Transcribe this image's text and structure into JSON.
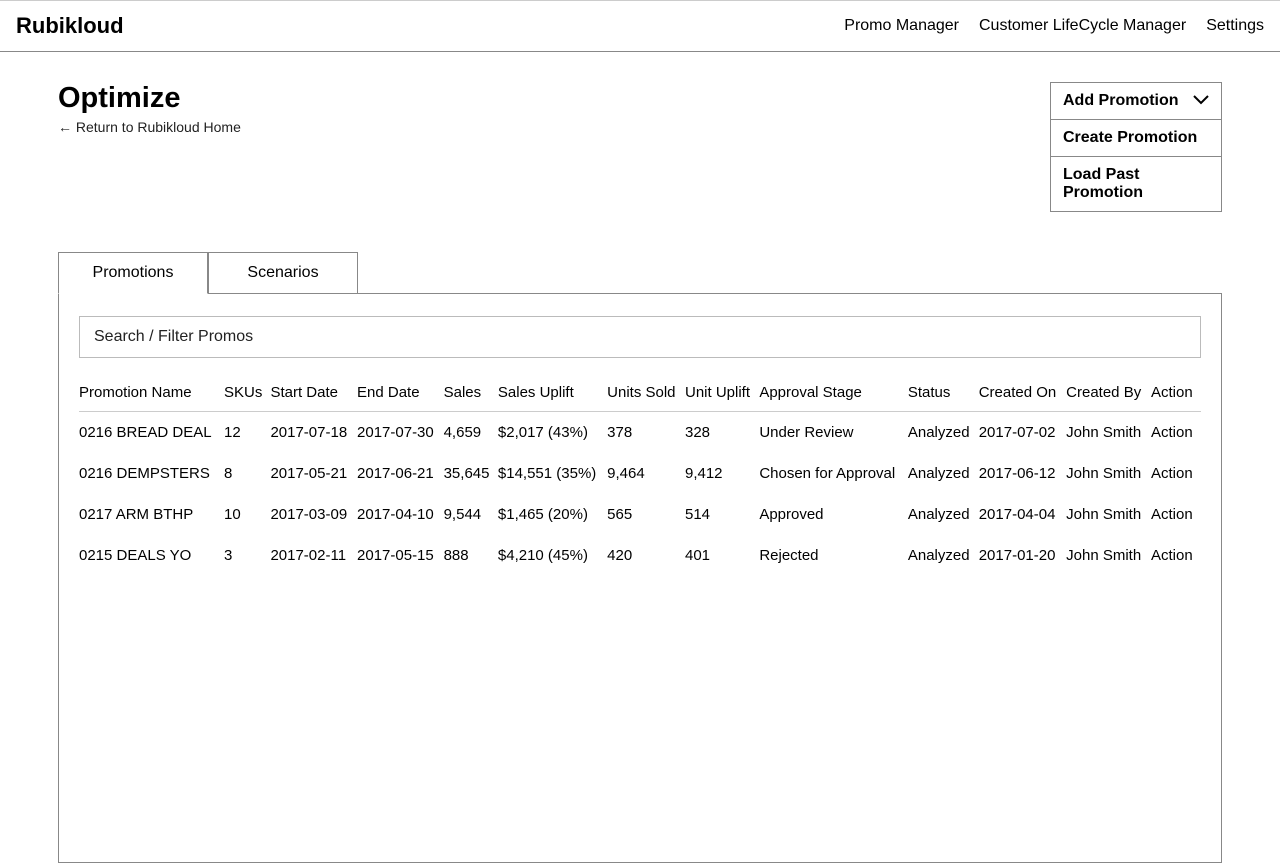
{
  "header": {
    "brand": "Rubikloud",
    "nav": [
      "Promo Manager",
      "Customer LifeCycle Manager",
      "Settings"
    ]
  },
  "page": {
    "title": "Optimize",
    "return_link": "← Return to Rubikloud Home"
  },
  "dropdown": {
    "label": "Add Promotion",
    "items": [
      "Create Promotion",
      "Load Past Promotion"
    ]
  },
  "tabs": {
    "items": [
      "Promotions",
      "Scenarios"
    ],
    "active": 0
  },
  "search": {
    "placeholder": "Search / Filter Promos"
  },
  "table": {
    "headers": [
      "Promotion Name",
      "SKUs",
      "Start Date",
      "End Date",
      "Sales",
      "Sales Uplift",
      "Units Sold",
      "Unit Uplift",
      "Approval Stage",
      "Status",
      "Created On",
      "Created By",
      "Action"
    ],
    "rows": [
      {
        "name": "0216 BREAD DEAL",
        "skus": "12",
        "start": "2017-07-18",
        "end": "2017-07-30",
        "sales": "4,659",
        "uplift": "$2,017 (43%)",
        "units": "378",
        "unit_uplift": "328",
        "stage": "Under Review",
        "status": "Analyzed",
        "created_on": "2017-07-02",
        "created_by": "John Smith",
        "action": "Action"
      },
      {
        "name": "0216 DEMPSTERS",
        "skus": "8",
        "start": "2017-05-21",
        "end": "2017-06-21",
        "sales": "35,645",
        "uplift": "$14,551 (35%)",
        "units": "9,464",
        "unit_uplift": "9,412",
        "stage": "Chosen for Approval",
        "status": "Analyzed",
        "created_on": "2017-06-12",
        "created_by": "John Smith",
        "action": "Action"
      },
      {
        "name": "0217 ARM BTHP",
        "skus": "10",
        "start": "2017-03-09",
        "end": "2017-04-10",
        "sales": "9,544",
        "uplift": "$1,465 (20%)",
        "units": "565",
        "unit_uplift": "514",
        "stage": "Approved",
        "status": "Analyzed",
        "created_on": "2017-04-04",
        "created_by": "John Smith",
        "action": "Action"
      },
      {
        "name": "0215 DEALS YO",
        "skus": "3",
        "start": "2017-02-11",
        "end": "2017-05-15",
        "sales": "888",
        "uplift": "$4,210 (45%)",
        "units": "420",
        "unit_uplift": "401",
        "stage": "Rejected",
        "status": "Analyzed",
        "created_on": "2017-01-20",
        "created_by": "John Smith",
        "action": "Action"
      }
    ]
  }
}
